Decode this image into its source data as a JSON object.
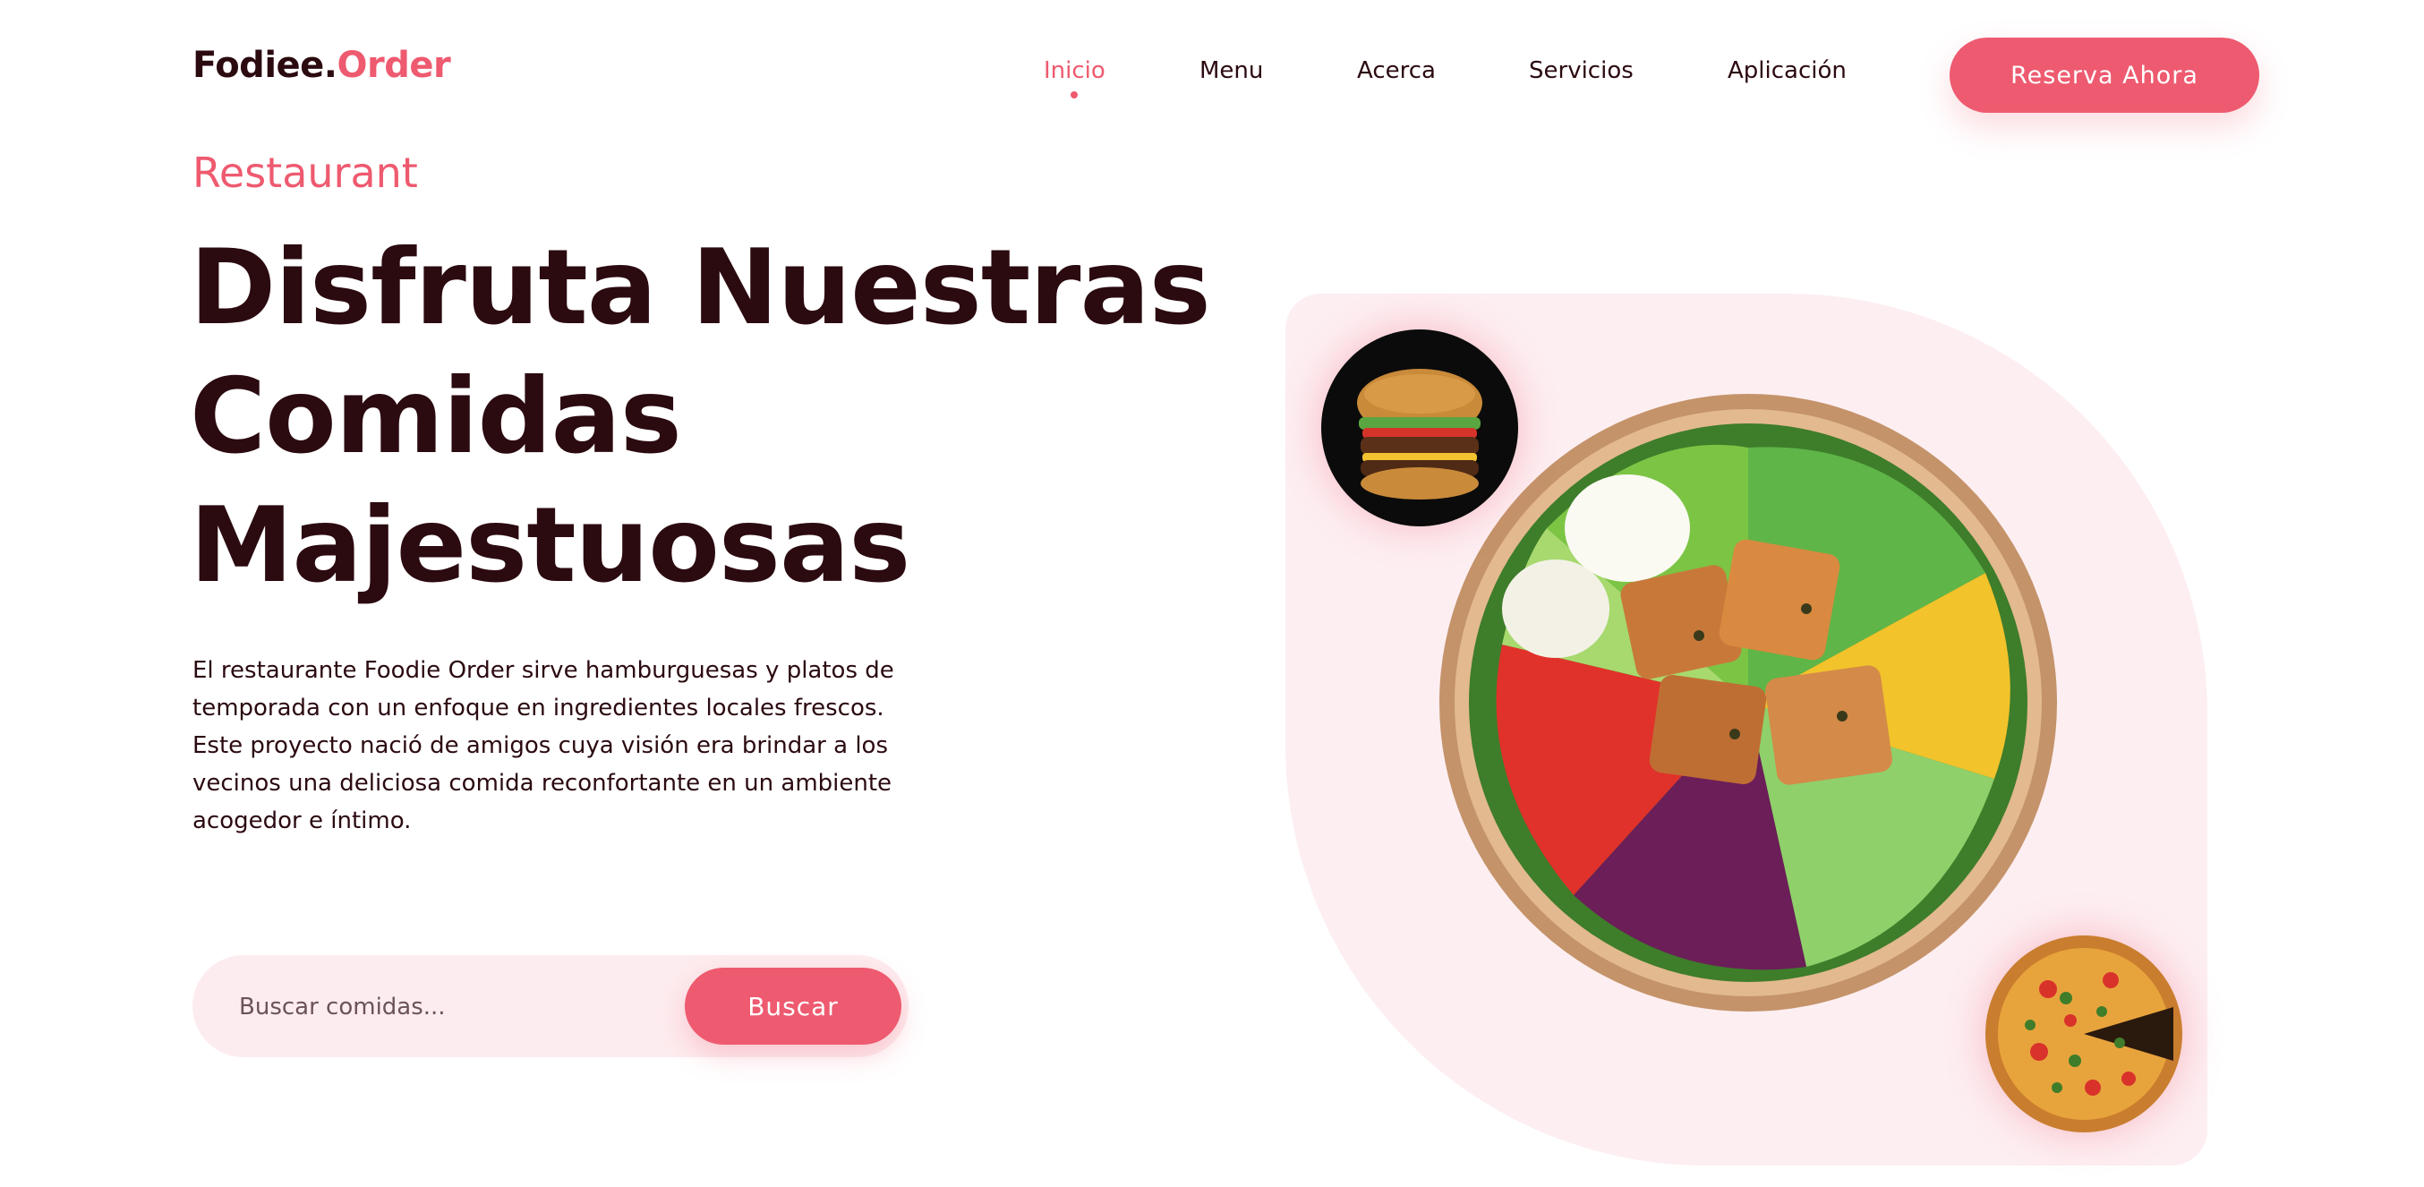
{
  "brand": {
    "name_part1": "Fodiee.",
    "name_part2": "Order"
  },
  "nav": {
    "items": [
      {
        "label": "Inicio",
        "active": true
      },
      {
        "label": "Menu",
        "active": false
      },
      {
        "label": "Acerca",
        "active": false
      },
      {
        "label": "Servicios",
        "active": false
      },
      {
        "label": "Aplicación",
        "active": false
      }
    ],
    "cta_label": "Reserva Ahora"
  },
  "hero": {
    "eyebrow": "Restaurant",
    "headline_lines": [
      "Disfruta Nuestras",
      "Comidas",
      "Majestuosas"
    ],
    "description": "El restaurante Foodie Order sirve hamburguesas y platos de temporada con un enfoque en ingredientes locales frescos. Este proyecto nació de amigos cuya visión era brindar a los vecinos una deliciosa comida reconfortante en un ambiente acogedor e íntimo.",
    "search": {
      "placeholder": "Buscar comidas...",
      "button_label": "Buscar"
    }
  },
  "images": {
    "main": "salad-bowl",
    "thumbnails": [
      "burger",
      "pizza"
    ]
  },
  "colors": {
    "accent": "#ee5a6f",
    "text": "#2b0a10",
    "hero_bg": "#fdeef1"
  }
}
